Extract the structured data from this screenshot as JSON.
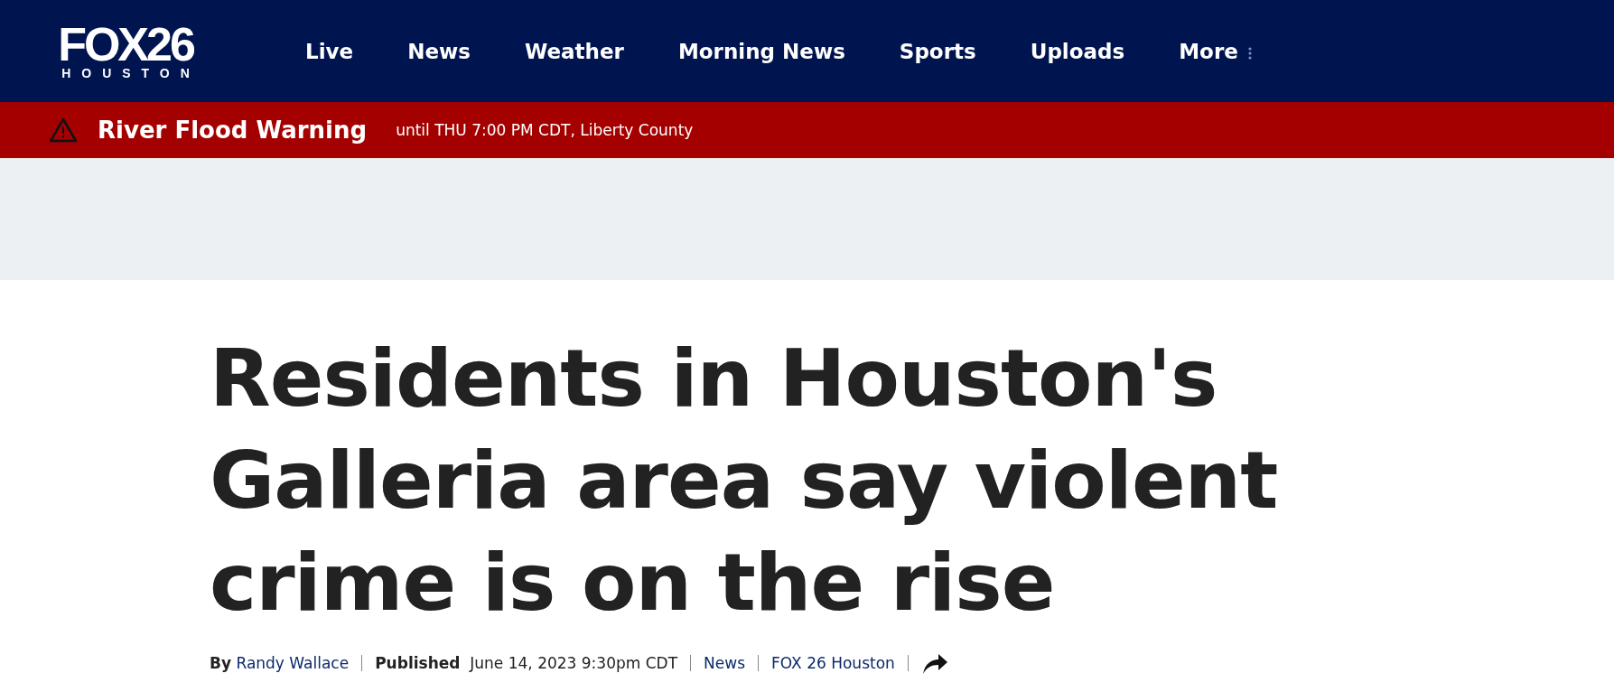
{
  "logo": {
    "brand": "FOX26",
    "city": "HOUSTON"
  },
  "nav": [
    {
      "label": "Live"
    },
    {
      "label": "News"
    },
    {
      "label": "Weather"
    },
    {
      "label": "Morning News"
    },
    {
      "label": "Sports"
    },
    {
      "label": "Uploads"
    },
    {
      "label": "More",
      "kind": "menu"
    }
  ],
  "alert": {
    "title": "River Flood Warning",
    "detail": "until THU 7:00 PM CDT, Liberty County"
  },
  "headline": "Residents in Houston's Galleria area say violent crime is on the rise",
  "byline": {
    "by_label": "By",
    "author": "Randy Wallace",
    "published_label": "Published",
    "date": "June 14, 2023 9:30pm CDT",
    "category": "News",
    "source": "FOX 26 Houston"
  }
}
